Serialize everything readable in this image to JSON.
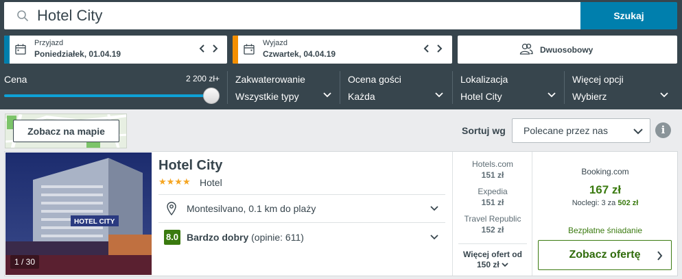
{
  "search": {
    "value": "Hotel City",
    "button_label": "Szukaj"
  },
  "dates": {
    "checkin": {
      "label": "Przyjazd",
      "value": "Poniedziałek, 01.04.19",
      "accent": "#007fad"
    },
    "checkout": {
      "label": "Wyjazd",
      "value": "Czwartek, 04.04.19",
      "accent": "#f48f00"
    }
  },
  "rooms": {
    "label": "Dwuosobowy"
  },
  "filters": {
    "price": {
      "label": "Cena",
      "max_label": "2 200 zł+",
      "level": 1.0
    },
    "accommodation": {
      "label": "Zakwaterowanie",
      "value": "Wszystkie typy"
    },
    "rating": {
      "label": "Ocena gości",
      "value": "Każda"
    },
    "location": {
      "label": "Lokalizacja",
      "value": "Hotel City"
    },
    "more": {
      "label": "Więcej opcji",
      "value": "Wybierz"
    }
  },
  "map": {
    "button_label": "Zobacz na mapie"
  },
  "sort": {
    "label": "Sortuj wg",
    "value": "Polecane przez nas",
    "info_icon": "i"
  },
  "hotel": {
    "photo_counter": "1 / 30",
    "name": "Hotel City",
    "stars": "★★★★",
    "type": "Hotel",
    "location": "Montesilvano, 0.1 km do plaży",
    "score": "8.0",
    "rating_label": "Bardzo dobry",
    "rating_count": "(opinie: 611)",
    "providers": [
      {
        "name": "Hotels.com",
        "price": "151 zł"
      },
      {
        "name": "Expedia",
        "price": "151 zł"
      },
      {
        "name": "Travel Republic",
        "price": "152 zł"
      }
    ],
    "more_offers_line1": "Więcej ofert od",
    "more_offers_line2": "150 zł",
    "deal": {
      "site": "Booking.com",
      "price": "167 zł",
      "nights_text": "Noclegi: 3 za",
      "nights_total": "502 zł",
      "breakfast": "Bezpłatne śniadanie",
      "cta_label": "Zobacz ofertę"
    }
  },
  "colors": {
    "header": "#37454d",
    "accent_blue": "#007fad",
    "accent_orange": "#f48f00",
    "deal_green": "#3a7a0f",
    "star": "#f5a623"
  }
}
